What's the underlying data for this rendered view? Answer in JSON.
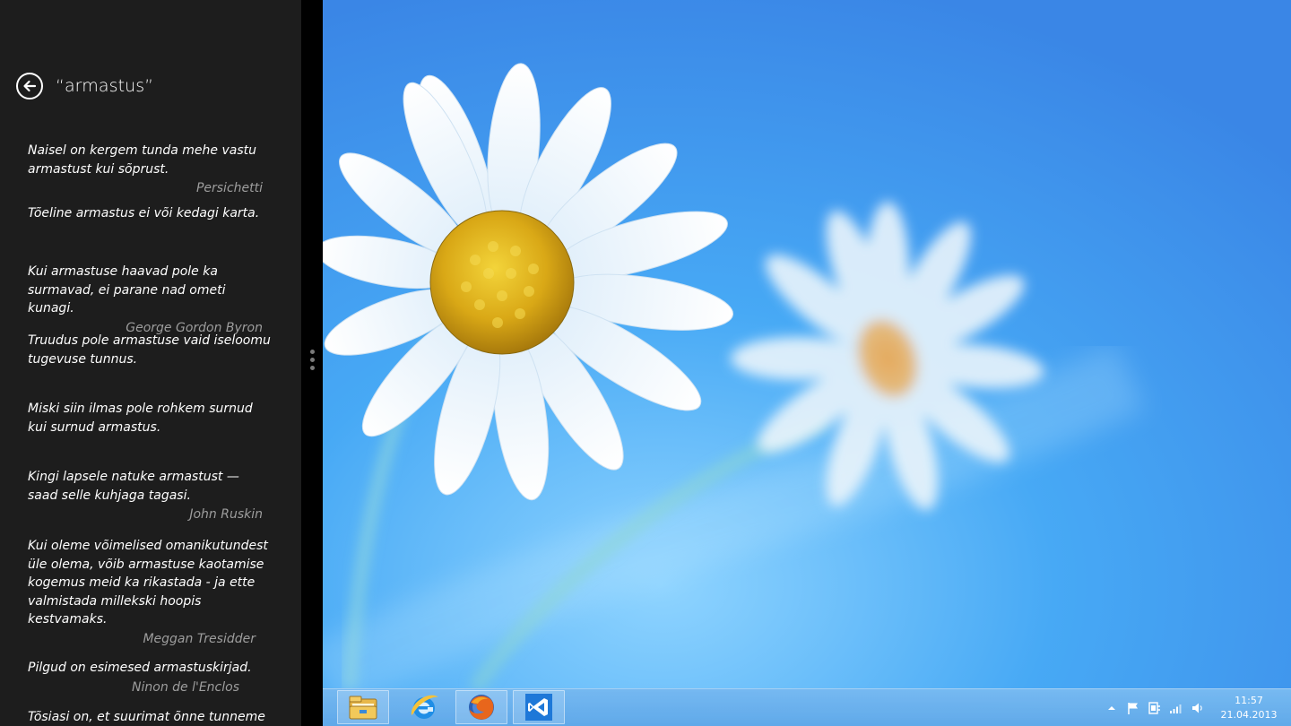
{
  "snap_app": {
    "search_title": "“armastus”",
    "quotes": [
      {
        "text": "Naisel on kergem tunda mehe vastu armastust kui sõprust.",
        "author": "Persichetti"
      },
      {
        "text": "Tõeline armastus ei või kedagi karta.",
        "author": ""
      },
      {
        "text": "Kui armastuse haavad pole ka surmavad, ei parane nad ometi kunagi.",
        "author": "George Gordon Byron"
      },
      {
        "text": "Truudus pole armastuse vaid iseloomu tugevuse tunnus.",
        "author": ""
      },
      {
        "text": "Miski siin ilmas pole rohkem surnud kui surnud armastus.",
        "author": ""
      },
      {
        "text": "Kingi lapsele natuke armastust — saad selle kuhjaga tagasi.",
        "author": "John Ruskin"
      },
      {
        "text": "Kui oleme võimelised omanikutundest üle olema, võib armastuse kaotamise kogemus meid ka rikastada - ja ette valmistada millekski hoopis kestvamaks.",
        "author": "Meggan Tresidder"
      },
      {
        "text": "Pilgud on esimesed armastuskirjad.",
        "author": "Ninon de l'Enclos"
      },
      {
        "text": "Tõsiasi on, et suurimat õnne tunneme",
        "author": ""
      }
    ]
  },
  "taskbar": {
    "pinned": [
      {
        "icon": "file-explorer-icon",
        "active": true
      },
      {
        "icon": "internet-explorer-icon",
        "active": false
      },
      {
        "icon": "firefox-icon",
        "active": true
      },
      {
        "icon": "visual-studio-icon",
        "active": true
      }
    ],
    "tray_icons": [
      "show-hidden-icons-arrow",
      "action-center-flag-icon",
      "power-icon",
      "network-signal-icon",
      "volume-icon"
    ],
    "clock": {
      "time": "11:57",
      "date": "21.04.2013"
    }
  },
  "colors": {
    "snap_background": "#1d1d1d",
    "author_gray": "#9d9d9d",
    "desktop_blue": "#2f8ff0"
  }
}
